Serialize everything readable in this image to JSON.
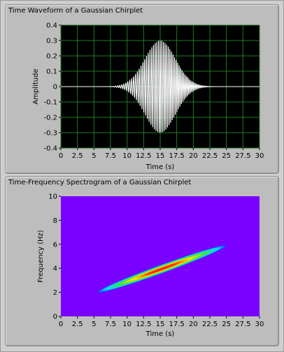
{
  "chart_data": [
    {
      "type": "line",
      "title": "Time Waveform of a Gaussian Chirplet",
      "xlabel": "Time (s)",
      "ylabel": "Amplitude",
      "xlim": [
        0,
        30
      ],
      "ylim": [
        -0.4,
        0.4
      ],
      "xticks": [
        "0",
        "2.5",
        "5",
        "7.5",
        "10",
        "12.5",
        "15",
        "17.5",
        "20",
        "22.5",
        "25",
        "27.5",
        "30"
      ],
      "yticks": [
        "0.4",
        "0.3",
        "0.2",
        "0.1",
        "0",
        "-0.1",
        "-0.2",
        "-0.3",
        "-0.4"
      ],
      "grid": true,
      "colors": {
        "plot_bg": "#000000",
        "grid": "#1f7a2a",
        "line": "#ffffff"
      },
      "series": [
        {
          "envelope_center_s": 15,
          "peak_amplitude": 0.3,
          "start_freq_hz": 2,
          "end_freq_hz": 6
        }
      ]
    },
    {
      "type": "heatmap",
      "title": "Time-Frequency Spectrogram of a Gaussian Chirplet",
      "xlabel": "Time (s)",
      "ylabel": "Frequency (Hz)",
      "xlim": [
        0,
        30
      ],
      "ylim": [
        0,
        10
      ],
      "xticks": [
        "0",
        "2.5",
        "5",
        "7.5",
        "10",
        "12.5",
        "15",
        "17.5",
        "20",
        "22.5",
        "25",
        "27.5",
        "30"
      ],
      "yticks": [
        "10",
        "8",
        "6",
        "4",
        "2",
        "0"
      ],
      "grid": false,
      "colors": {
        "background": "#7a00ff",
        "low": "#1e2dff",
        "mid_low": "#00d8ff",
        "mid": "#39e04a",
        "mid_high": "#ffe800",
        "high": "#ff2a00"
      },
      "ridge": {
        "start": [
          5.5,
          2.0
        ],
        "end": [
          25,
          5.9
        ]
      }
    }
  ]
}
